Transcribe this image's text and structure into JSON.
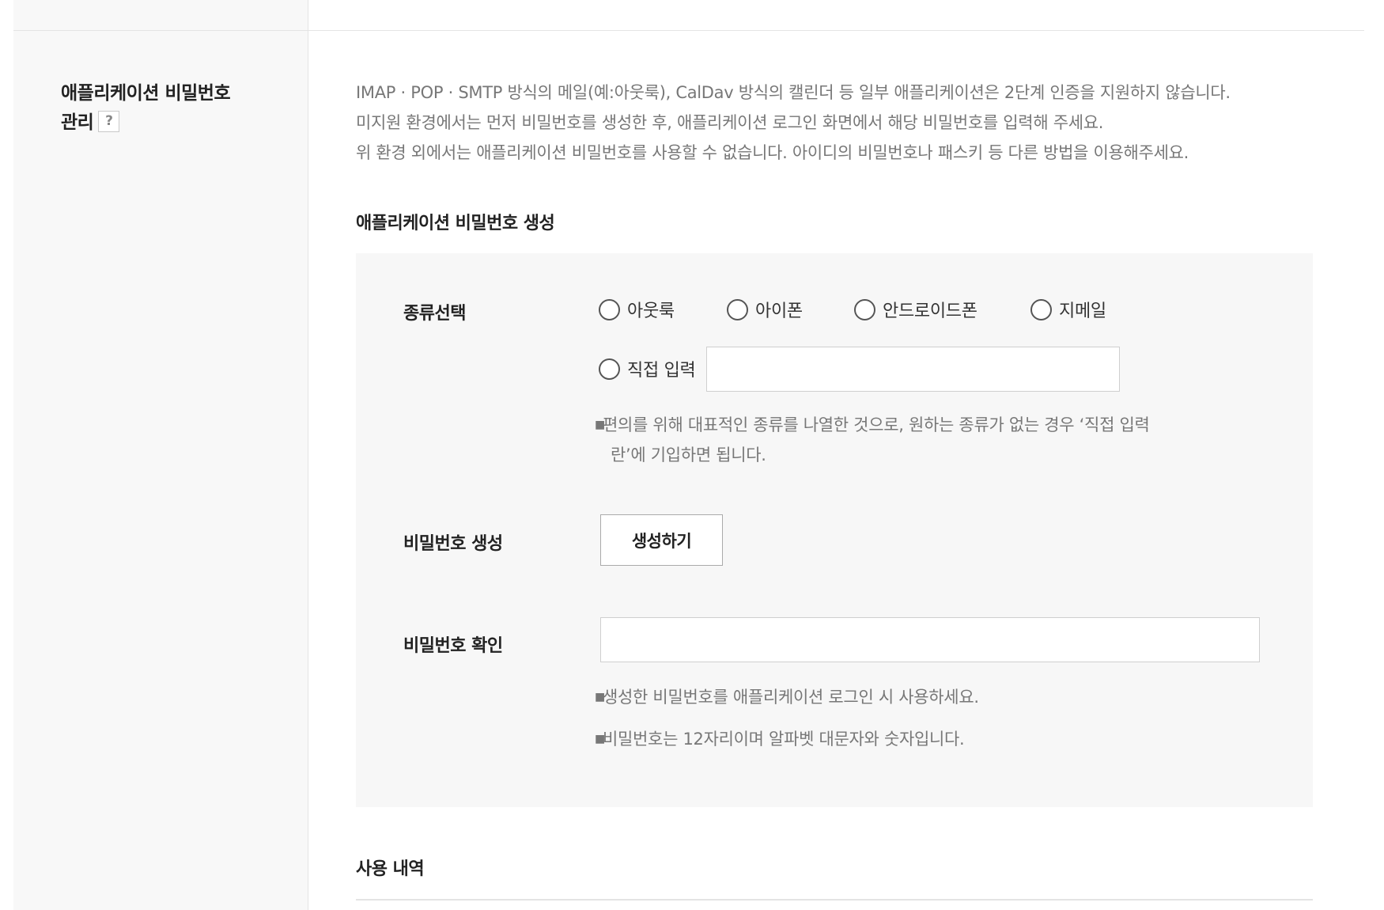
{
  "section": {
    "title_line1": "애플리케이션 비밀번호",
    "title_line2": "관리",
    "help_glyph": "?"
  },
  "description": {
    "lines": [
      "IMAP · POP · SMTP 방식의 메일(예:아웃룩), CalDav 방식의 캘린더 등 일부 애플리케이션은 2단계 인증을 지원하지 않습니다.",
      "미지원 환경에서는 먼저 비밀번호를 생성한 후, 애플리케이션 로그인 화면에서 해당 비밀번호를 입력해 주세요.",
      "위 환경 외에서는 애플리케이션 비밀번호를 사용할 수 없습니다. 아이디의 비밀번호나 패스키 등 다른 방법을 이용해주세요."
    ]
  },
  "create": {
    "heading": "애플리케이션 비밀번호 생성",
    "type": {
      "label": "종류선택",
      "options": [
        "아웃룩",
        "아이폰",
        "안드로이드폰",
        "지메일",
        "직접 입력"
      ],
      "custom_value": "",
      "note_line1": "편의를 위해 대표적인 종류를 나열한 것으로, 원하는 종류가 없는 경우 ‘직접 입력",
      "note_line2": "란’에 기입하면 됩니다."
    },
    "generate": {
      "label": "비밀번호 생성",
      "button": "생성하기"
    },
    "confirm": {
      "label": "비밀번호 확인",
      "value": "",
      "note1": "생성한 비밀번호를 애플리케이션 로그인 시 사용하세요.",
      "note2": "비밀번호는 12자리이며 알파벳 대문자와 숫자입니다."
    }
  },
  "history": {
    "heading": "사용 내역"
  }
}
